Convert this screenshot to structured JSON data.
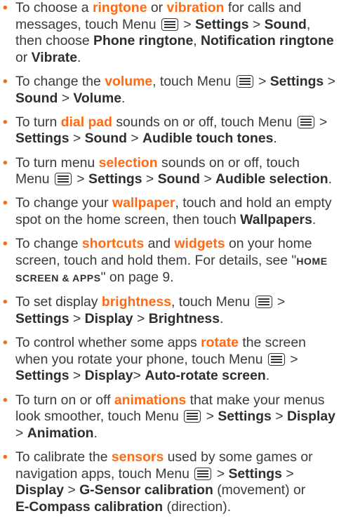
{
  "items": [
    {
      "lines": [
        [
          [
            "t",
            "To choose a "
          ],
          [
            "h",
            "ringtone"
          ],
          [
            "t",
            " or "
          ],
          [
            "h",
            "vibration"
          ],
          [
            "t",
            " for calls and"
          ]
        ],
        [
          [
            "t",
            "messages, touch Menu "
          ],
          [
            "i",
            "menu-icon"
          ],
          [
            "t",
            " > "
          ],
          [
            "b",
            "Settings"
          ],
          [
            "t",
            " > "
          ],
          [
            "b",
            "Sound"
          ],
          [
            "t",
            ","
          ]
        ],
        [
          [
            "t",
            "then choose "
          ],
          [
            "b",
            "Phone ringtone"
          ],
          [
            "t",
            ", "
          ],
          [
            "b",
            "Notification ringtone"
          ]
        ],
        [
          [
            "t",
            "or "
          ],
          [
            "b",
            "Vibrate"
          ],
          [
            "t",
            "."
          ]
        ]
      ]
    },
    {
      "lines": [
        [
          [
            "t",
            "To change the "
          ],
          [
            "h",
            "volume"
          ],
          [
            "t",
            ", touch Menu "
          ],
          [
            "i",
            "menu-icon"
          ],
          [
            "t",
            " > "
          ],
          [
            "b",
            "Settings"
          ],
          [
            "t",
            " >"
          ]
        ],
        [
          [
            "b",
            "Sound"
          ],
          [
            "t",
            " > "
          ],
          [
            "b",
            "Volume"
          ],
          [
            "t",
            "."
          ]
        ]
      ]
    },
    {
      "lines": [
        [
          [
            "t",
            "To turn "
          ],
          [
            "h",
            "dial pad"
          ],
          [
            "t",
            " sounds on or off, touch Menu "
          ],
          [
            "i",
            "menu-icon"
          ],
          [
            "t",
            " >"
          ]
        ],
        [
          [
            "b",
            "Settings"
          ],
          [
            "t",
            " > "
          ],
          [
            "b",
            "Sound"
          ],
          [
            "t",
            " > "
          ],
          [
            "b",
            "Audible touch tones"
          ],
          [
            "t",
            "."
          ]
        ]
      ]
    },
    {
      "lines": [
        [
          [
            "t",
            "To turn menu "
          ],
          [
            "h",
            "selection"
          ],
          [
            "t",
            " sounds on or off, touch"
          ]
        ],
        [
          [
            "t",
            "Menu "
          ],
          [
            "i",
            "menu-icon"
          ],
          [
            "t",
            " > "
          ],
          [
            "b",
            "Settings"
          ],
          [
            "t",
            " > "
          ],
          [
            "b",
            "Sound"
          ],
          [
            "t",
            " > "
          ],
          [
            "b",
            "Audible selection"
          ],
          [
            "t",
            "."
          ]
        ]
      ]
    },
    {
      "lines": [
        [
          [
            "t",
            "To change your "
          ],
          [
            "h",
            "wallpaper"
          ],
          [
            "t",
            ", touch and hold an empty"
          ]
        ],
        [
          [
            "t",
            "spot on the home screen, then touch "
          ],
          [
            "b",
            "Wallpapers"
          ],
          [
            "t",
            "."
          ]
        ]
      ]
    },
    {
      "lines": [
        [
          [
            "t",
            "To change "
          ],
          [
            "h",
            "shortcuts"
          ],
          [
            "t",
            " and "
          ],
          [
            "h",
            "widgets"
          ],
          [
            "t",
            " on your home"
          ]
        ],
        [
          [
            "t",
            "screen, touch and hold them. For details, see \""
          ],
          [
            "s",
            "HOME"
          ]
        ],
        [
          [
            "s",
            "SCREEN & APPS"
          ],
          [
            "t",
            "\" on page 9."
          ]
        ]
      ]
    },
    {
      "lines": [
        [
          [
            "t",
            "To set display "
          ],
          [
            "h",
            "brightness"
          ],
          [
            "t",
            ", touch Menu "
          ],
          [
            "i",
            "menu-icon"
          ],
          [
            "t",
            " >"
          ]
        ],
        [
          [
            "b",
            "Settings"
          ],
          [
            "t",
            " > "
          ],
          [
            "b",
            "Display"
          ],
          [
            "t",
            " > "
          ],
          [
            "b",
            "Brightness"
          ],
          [
            "t",
            "."
          ]
        ]
      ]
    },
    {
      "lines": [
        [
          [
            "t",
            "To control whether some apps "
          ],
          [
            "h",
            "rotate"
          ],
          [
            "t",
            " the screen"
          ]
        ],
        [
          [
            "t",
            "when you rotate your phone, touch Menu "
          ],
          [
            "i",
            "menu-icon"
          ],
          [
            "t",
            " >"
          ]
        ],
        [
          [
            "b",
            "Settings"
          ],
          [
            "t",
            " > "
          ],
          [
            "b",
            "Display"
          ],
          [
            "t",
            ">  "
          ],
          [
            "b",
            "Auto-rotate screen"
          ],
          [
            "t",
            "."
          ]
        ]
      ]
    },
    {
      "lines": [
        [
          [
            "t",
            "To turn on or off "
          ],
          [
            "h",
            "animations"
          ],
          [
            "t",
            " that make your menus"
          ]
        ],
        [
          [
            "t",
            "look smoother, touch Menu "
          ],
          [
            "i",
            "menu-icon"
          ],
          [
            "t",
            " > "
          ],
          [
            "b",
            "Settings"
          ],
          [
            "t",
            " > "
          ],
          [
            "b",
            "Display"
          ]
        ],
        [
          [
            "t",
            "> "
          ],
          [
            "b",
            "Animation"
          ],
          [
            "t",
            "."
          ]
        ]
      ]
    },
    {
      "lines": [
        [
          [
            "t",
            "To calibrate the "
          ],
          [
            "h",
            "sensors"
          ],
          [
            "t",
            " used by some games or"
          ]
        ],
        [
          [
            "t",
            "navigation apps, touch Menu "
          ],
          [
            "i",
            "menu-icon"
          ],
          [
            "t",
            " > "
          ],
          [
            "b",
            "Settings"
          ],
          [
            "t",
            " >"
          ]
        ],
        [
          [
            "b",
            "Display"
          ],
          [
            "t",
            " > "
          ],
          [
            "b",
            "G-Sensor calibration"
          ],
          [
            "t",
            " (movement) or"
          ]
        ],
        [
          [
            "b",
            "E-Compass calibration"
          ],
          [
            "t",
            " (direction)."
          ]
        ]
      ]
    }
  ]
}
